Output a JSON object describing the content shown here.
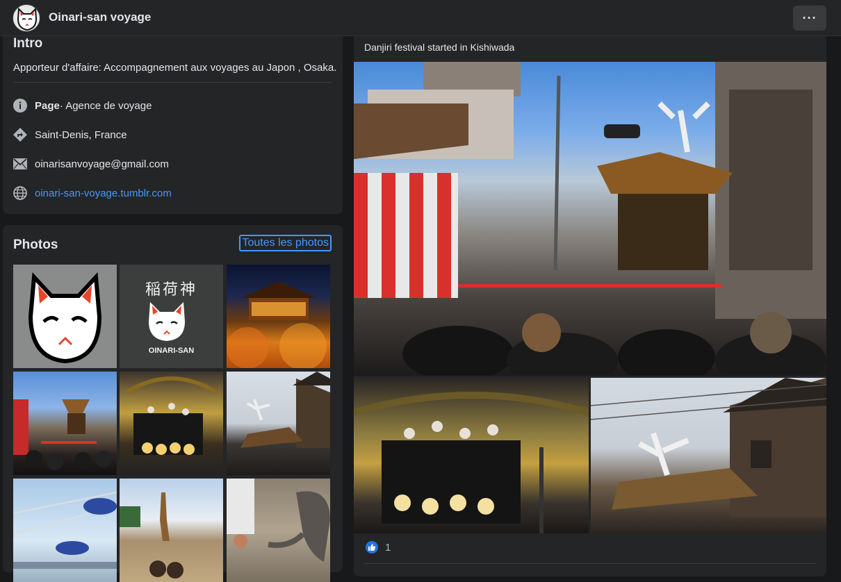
{
  "header": {
    "page_name": "Oinari-san voyage",
    "more_label": "···"
  },
  "intro": {
    "title": "Intro",
    "description": "Apporteur d'affaire: Accompagnement aux voyages au Japon , Osaka.",
    "category_label": "Page",
    "category_value": " · Agence de voyage",
    "location": "Saint-Denis, France",
    "email": "oinarisanvoyage@gmail.com",
    "website": "oinari-san-voyage.tumblr.com"
  },
  "photos": {
    "title": "Photos",
    "see_all_label": "Toutes les photos",
    "thumbs": [
      {
        "name": "fox-mask-logo"
      },
      {
        "name": "oinari-san-logo",
        "caption_jp": "稲荷神",
        "caption": "OINARI-SAN"
      },
      {
        "name": "temple-night"
      },
      {
        "name": "danjiri-street"
      },
      {
        "name": "danjiri-crowd-night"
      },
      {
        "name": "danjiri-roof-dancer"
      },
      {
        "name": "amusement-ride"
      },
      {
        "name": "zoo-giraffe"
      },
      {
        "name": "zoo-elephant"
      }
    ]
  },
  "post": {
    "text": "Danjiri festival started in Kishiwada",
    "like_count": "1"
  },
  "colors": {
    "background": "#18191a",
    "card": "#242526",
    "link": "#4599ff",
    "like": "#2374e1"
  }
}
